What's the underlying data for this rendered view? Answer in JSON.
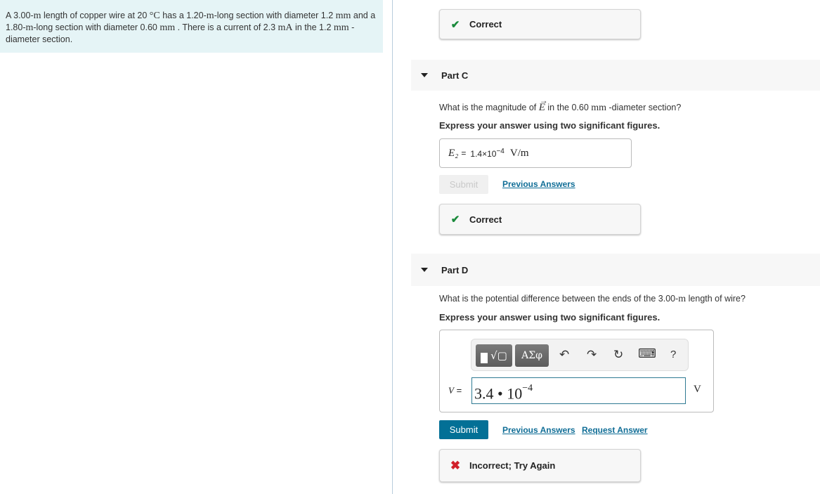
{
  "problem": {
    "segments": [
      {
        "t": "A 3.00-",
        "m": false
      },
      {
        "t": "m",
        "m": true
      },
      {
        "t": " length of copper wire at 20 ",
        "m": false
      },
      {
        "t": "°C",
        "m": true
      },
      {
        "t": " has a 1.20-",
        "m": false
      },
      {
        "t": "m",
        "m": true
      },
      {
        "t": "-long section with diameter 1.2 ",
        "m": false
      },
      {
        "t": "mm",
        "m": true
      },
      {
        "t": " and a 1.80-",
        "m": false
      },
      {
        "t": "m",
        "m": true
      },
      {
        "t": "-long section with diameter 0.60 ",
        "m": false
      },
      {
        "t": "mm",
        "m": true
      },
      {
        "t": " . There is a current of 2.3 ",
        "m": false
      },
      {
        "t": "mA",
        "m": true
      },
      {
        "t": " in the 1.2 ",
        "m": false
      },
      {
        "t": "mm",
        "m": true
      },
      {
        "t": " -diameter section.",
        "m": false
      }
    ]
  },
  "feedback_top": {
    "icon": "check-icon",
    "text": "Correct"
  },
  "partC": {
    "title": "Part C",
    "question_pre": "What is the magnitude of ",
    "question_var": "E",
    "question_mid": " in the 0.60 ",
    "question_unit": "mm",
    "question_post": " -diameter section?",
    "instruction": "Express your answer using two significant figures.",
    "answer": {
      "variable": "E₂",
      "equals": "=",
      "value": "1.4×10",
      "exp": "−4",
      "unit": "V/m"
    },
    "submit_label": "Submit",
    "previous_answers": "Previous Answers",
    "feedback": {
      "icon": "check-icon",
      "text": "Correct"
    }
  },
  "partD": {
    "title": "Part D",
    "question_pre": "What is the potential difference between the ends of the 3.00-",
    "question_unit": "m",
    "question_post": " length of wire?",
    "instruction": "Express your answer using two significant figures.",
    "toolbar": {
      "templates": "▯∜▢",
      "symbols": "ΑΣφ",
      "undo": "↶",
      "redo": "↷",
      "reset": "↻",
      "keyboard": "⌨",
      "help": "?"
    },
    "variable": "V",
    "equals": "=",
    "input_value": "3.4 • 10",
    "input_exp": "−4",
    "unit": "V",
    "submit_label": "Submit",
    "previous_answers": "Previous Answers",
    "request_answer": "Request Answer",
    "feedback": {
      "icon": "x-icon",
      "text": "Incorrect; Try Again"
    }
  },
  "colors": {
    "accent": "#037096",
    "correct": "#1a8a3b",
    "incorrect": "#d1202a",
    "problem_bg": "#e5f4f6"
  }
}
